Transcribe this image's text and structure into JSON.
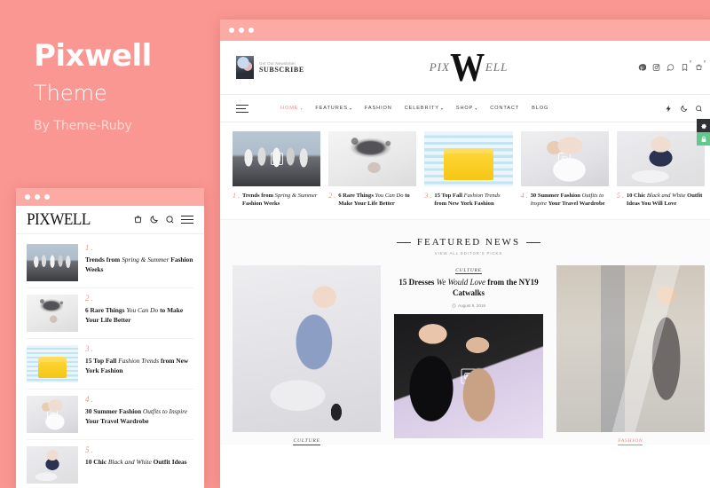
{
  "promo": {
    "title": "Pixwell",
    "subtitle": "Theme",
    "byline": "By Theme-Ruby"
  },
  "desktop": {
    "newsletter": {
      "top_label": "Get Our Newsletter",
      "cta": "SUBSCRIBE"
    },
    "logo": {
      "left": "PIX",
      "mark": "W",
      "right": "ELL"
    },
    "social": [
      {
        "name": "pinterest-icon",
        "badge": ""
      },
      {
        "name": "instagram-icon",
        "badge": ""
      },
      {
        "name": "whatsapp-icon",
        "badge": ""
      },
      {
        "name": "bookmark-icon",
        "badge": "0"
      },
      {
        "name": "cart-icon",
        "badge": "0"
      }
    ],
    "nav": [
      {
        "label": "HOME",
        "caret": "▾",
        "active": true
      },
      {
        "label": "FEATURES",
        "caret": "▾",
        "active": false
      },
      {
        "label": "FASHION",
        "caret": "",
        "active": false
      },
      {
        "label": "CELEBRITY",
        "caret": "▾",
        "active": false
      },
      {
        "label": "SHOP",
        "caret": "▾",
        "active": false
      },
      {
        "label": "CONTACT",
        "caret": "",
        "active": false
      },
      {
        "label": "BLOG",
        "caret": "",
        "active": false
      }
    ],
    "nav_icons": [
      "bolt-icon",
      "moon-icon",
      "search-icon"
    ],
    "trending": [
      {
        "num": "1 .",
        "t1": "Trends from ",
        "t2": "Spring & Summer ",
        "t3": "Fashion Weeks",
        "photo": "ph-runway"
      },
      {
        "num": "2 .",
        "t1": "6 Rare Things ",
        "t2": "You Can Do ",
        "t3": "to Make Your Life Better",
        "photo": "ph-hair"
      },
      {
        "num": "3 .",
        "t1": "15 Top Fall ",
        "t2": "Fashion Trends ",
        "t3": "from New York Fashion",
        "photo": "ph-chair"
      },
      {
        "num": "4 .",
        "t1": "30 Summer Fashion ",
        "t2": "Outfits to Inspire ",
        "t3": "Your Travel Wardrobe",
        "photo": "ph-girl"
      },
      {
        "num": "5 .",
        "t1": "10 Chic ",
        "t2": "Black and White ",
        "t3": "Outfit Ideas You Will Love",
        "photo": "ph-chic"
      }
    ],
    "featured": {
      "heading": "FEATURED NEWS",
      "subheading": "VIEW ALL EDITOR'S PICKS",
      "left": {
        "category": "CULTURE",
        "photo": "ph-dress"
      },
      "center": {
        "category": "CULTURE",
        "t1": "15 Dresses ",
        "t2": "We Would Love ",
        "t3": "from the NY19 Catwalks",
        "date": "August 9, 2019",
        "photo": "ph-black"
      },
      "right": {
        "category": "FASHION",
        "photo": "ph-street"
      }
    }
  },
  "side_tools": [
    {
      "name": "gear-icon",
      "style": "dark"
    },
    {
      "name": "lock-icon",
      "style": "green"
    }
  ],
  "mobile": {
    "logo": "PIXWELL",
    "icons": [
      "cart-icon",
      "moon-icon",
      "search-icon",
      "menu-icon"
    ],
    "list": [
      {
        "num": "1 .",
        "t1": "Trends from ",
        "t2": "Spring & Summer",
        "t3": " Fashion Weeks",
        "photo": "ph-runway"
      },
      {
        "num": "2 .",
        "t1": "6 Rare Things ",
        "t2": "You Can Do ",
        "t3": "to Make Your Life Better",
        "photo": "ph-hair"
      },
      {
        "num": "3 .",
        "t1": "15 Top Fall ",
        "t2": "Fashion Trends ",
        "t3": "from New York Fashion",
        "photo": "ph-chair"
      },
      {
        "num": "4 .",
        "t1": "30 Summer Fashion ",
        "t2": "Outfits to Inspire ",
        "t3": "Your Travel Wardrobe",
        "photo": "ph-girl"
      },
      {
        "num": "5 .",
        "t1": "10 Chic ",
        "t2": "Black and White ",
        "t3": "Outfit Ideas",
        "photo": "ph-chic"
      }
    ]
  },
  "colors": {
    "background": "#fb9792",
    "chrome": "#fcaaa4",
    "accent": "#f0928e",
    "lock_green": "#62c98c",
    "gear_dark": "#2f3134"
  }
}
